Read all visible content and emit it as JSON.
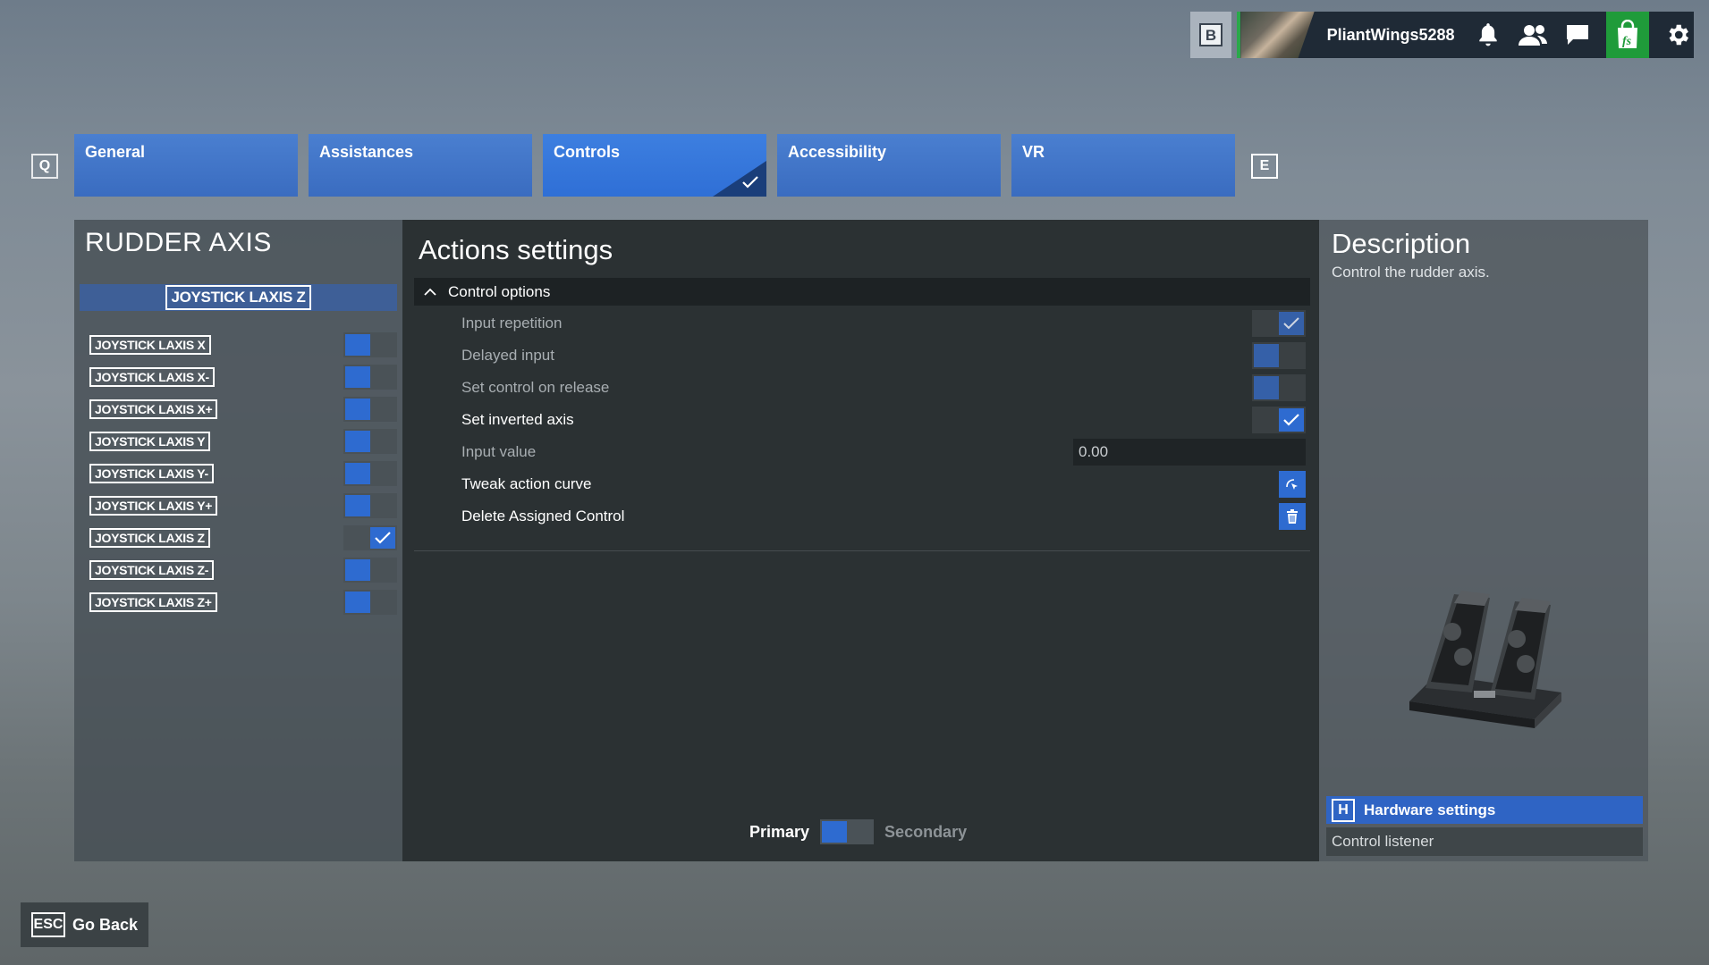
{
  "header": {
    "b_key": "B",
    "username": "PliantWings5288",
    "icons": [
      "bell-icon",
      "friends-icon",
      "chat-icon",
      "marketplace-icon",
      "settings-gear-icon"
    ]
  },
  "tabs": {
    "prev_key": "Q",
    "next_key": "E",
    "items": [
      {
        "label": "General"
      },
      {
        "label": "Assistances"
      },
      {
        "label": "Controls"
      },
      {
        "label": "Accessibility"
      },
      {
        "label": "VR"
      }
    ],
    "active": "Controls"
  },
  "left_panel": {
    "title": "RUDDER AXIS",
    "selected": "JOYSTICK LAXIS Z",
    "bindings": [
      {
        "label": "JOYSTICK LAXIS X",
        "checked": false
      },
      {
        "label": "JOYSTICK LAXIS X-",
        "checked": false
      },
      {
        "label": "JOYSTICK LAXIS X+",
        "checked": false
      },
      {
        "label": "JOYSTICK LAXIS Y",
        "checked": false
      },
      {
        "label": "JOYSTICK LAXIS Y-",
        "checked": false
      },
      {
        "label": "JOYSTICK LAXIS Y+",
        "checked": false
      },
      {
        "label": "JOYSTICK LAXIS Z",
        "checked": true
      },
      {
        "label": "JOYSTICK LAXIS Z-",
        "checked": false
      },
      {
        "label": "JOYSTICK LAXIS Z+",
        "checked": false
      }
    ]
  },
  "actions": {
    "title": "Actions settings",
    "section": "Control options",
    "options": {
      "input_repetition": "Input repetition",
      "delayed_input": "Delayed input",
      "set_control_on_release": "Set control on release",
      "set_inverted_axis": "Set inverted axis",
      "input_value": "Input value",
      "input_value_current": "0.00",
      "tweak_action_curve": "Tweak action curve",
      "delete_assigned_control": "Delete Assigned Control"
    },
    "primary_label": "Primary",
    "secondary_label": "Secondary"
  },
  "description": {
    "title": "Description",
    "text": "Control the rudder axis.",
    "image": "rudder-pedals-image",
    "hardware_key": "H",
    "hardware_settings": "Hardware settings",
    "control_listener": "Control listener"
  },
  "footer": {
    "esc_key": "ESC",
    "go_back": "Go Back"
  },
  "colors": {
    "accent_blue": "#2e6bd0",
    "online_green": "#2aa84a"
  }
}
